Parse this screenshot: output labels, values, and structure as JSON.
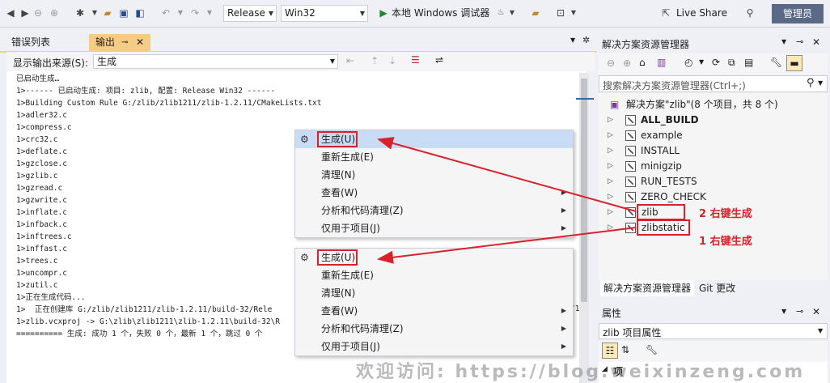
{
  "toolbar": {
    "configuration": "Release",
    "platform": "Win32",
    "run_label": "本地 Windows 调试器",
    "live_share": "Live Share",
    "admin": "管理员"
  },
  "output_panel": {
    "tab_errors": "错误列表",
    "tab_output": "输出",
    "source_label": "显示输出来源(S):",
    "source_value": "生成",
    "lines": [
      "已启动生成…",
      "1>------ 已启动生成: 项目: zlib, 配置: Release Win32 ------",
      "1>Building Custom Rule G:/zlib/zlib1211/zlib-1.2.11/CMakeLists.txt",
      "1>adler32.c",
      "1>compress.c",
      "1>crc32.c",
      "1>deflate.c",
      "1>gzclose.c",
      "1>gzlib.c",
      "1>gzread.c",
      "1>gzwrite.c",
      "1>inflate.c",
      "1>infback.c",
      "1>inftrees.c",
      "1>inffast.c",
      "1>trees.c",
      "1>uncompr.c",
      "1>zutil.c",
      "1>正在生成代码...",
      "1>  正在创建库 G:/zlib/zlib1211/zlib-1.2.11/build-32/Rele",
      "1>zlib.vcxproj -> G:\\zlib\\zlib1211\\zlib-1.2.11\\build-32\\R",
      "========== 生成: 成功 1 个，失败 0 个，最新 1 个，跳过 0 个"
    ],
    "line_tail": "/1"
  },
  "context_menu_top": {
    "items": [
      {
        "label": "生成(U)",
        "submenu": false
      },
      {
        "label": "重新生成(E)",
        "submenu": false
      },
      {
        "label": "清理(N)",
        "submenu": false
      },
      {
        "label": "查看(W)",
        "submenu": true
      },
      {
        "label": "分析和代码清理(Z)",
        "submenu": true
      },
      {
        "label": "仅用于项目(J)",
        "submenu": true
      }
    ]
  },
  "context_menu_bottom": {
    "items": [
      {
        "label": "生成(U)",
        "submenu": false
      },
      {
        "label": "重新生成(E)",
        "submenu": false
      },
      {
        "label": "清理(N)",
        "submenu": false
      },
      {
        "label": "查看(W)",
        "submenu": true
      },
      {
        "label": "分析和代码清理(Z)",
        "submenu": true
      },
      {
        "label": "仅用于项目(J)",
        "submenu": true
      }
    ]
  },
  "solution_explorer": {
    "title": "解决方案资源管理器",
    "search_placeholder": "搜索解决方案资源管理器(Ctrl+;)",
    "solution_label": "解决方案\"zlib\"(8 个项目，共 8 个)",
    "projects": [
      "ALL_BUILD",
      "example",
      "INSTALL",
      "minigzip",
      "RUN_TESTS",
      "ZERO_CHECK",
      "zlib",
      "zlibstatic"
    ],
    "tab_se": "解决方案资源管理器",
    "tab_git": "Git 更改"
  },
  "properties": {
    "title": "属性",
    "selected": "zlib 项目属性",
    "row_label": "项"
  },
  "annotations": {
    "step2": "2 右键生成",
    "step1": "1 右键生成"
  },
  "watermark": "欢迎访问: https://blog.weixinzeng.com",
  "colors": {
    "accent_red": "#d9212c",
    "active_tab": "#f5cc84",
    "highlight": "#c9dcf5",
    "admin_bg": "#5a6a86"
  }
}
